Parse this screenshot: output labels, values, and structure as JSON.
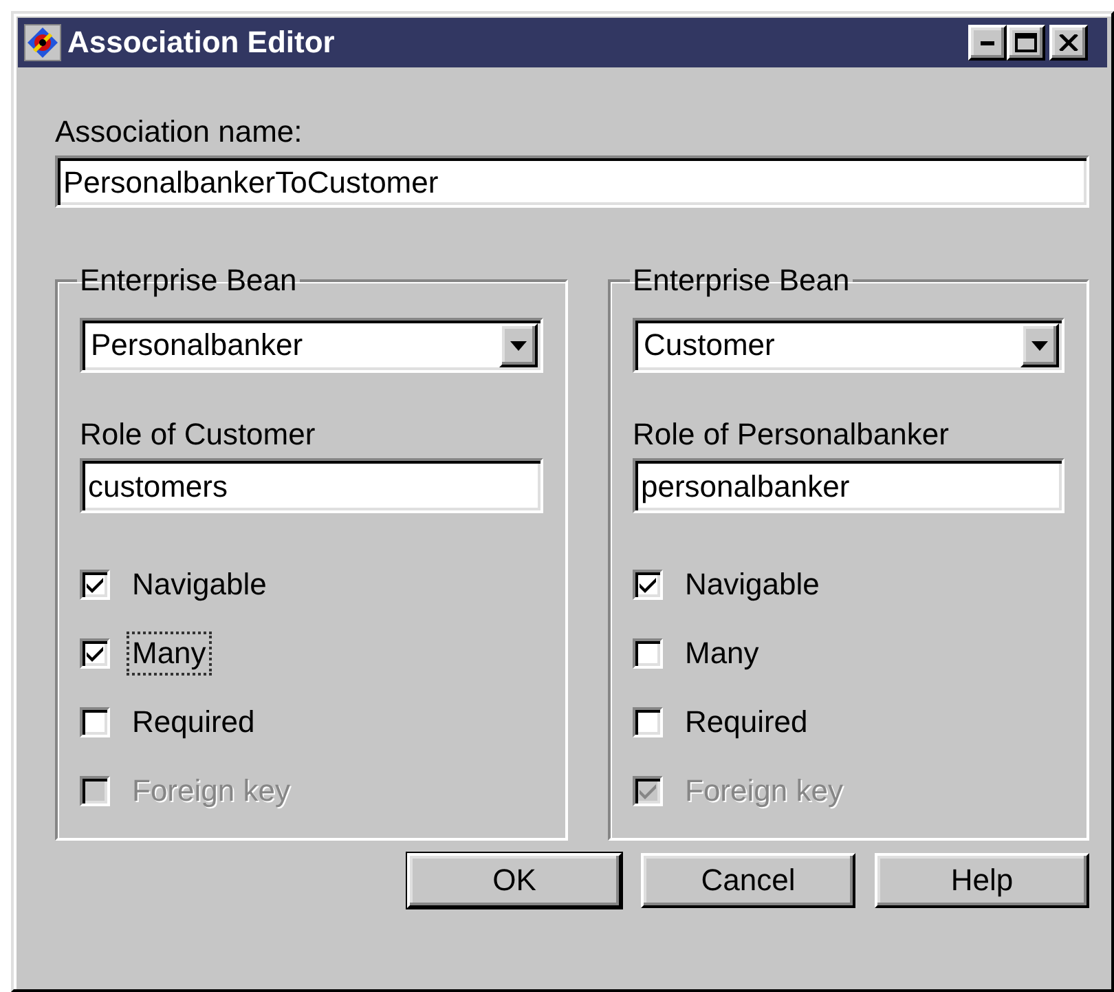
{
  "window": {
    "title": "Association Editor"
  },
  "association_name": {
    "label": "Association name:",
    "value": "PersonalbankerToCustomer"
  },
  "ends": [
    {
      "group_title": "Enterprise Bean",
      "bean": "Personalbanker",
      "role_label": "Role of Customer",
      "role_value": "customers",
      "options": [
        {
          "label": "Navigable",
          "checked": true,
          "disabled": false,
          "focused": false
        },
        {
          "label": "Many",
          "checked": true,
          "disabled": false,
          "focused": true
        },
        {
          "label": "Required",
          "checked": false,
          "disabled": false,
          "focused": false
        },
        {
          "label": "Foreign key",
          "checked": false,
          "disabled": true,
          "focused": false
        }
      ]
    },
    {
      "group_title": "Enterprise Bean",
      "bean": "Customer",
      "role_label": "Role of Personalbanker",
      "role_value": "personalbanker",
      "options": [
        {
          "label": "Navigable",
          "checked": true,
          "disabled": false,
          "focused": false
        },
        {
          "label": "Many",
          "checked": false,
          "disabled": false,
          "focused": false
        },
        {
          "label": "Required",
          "checked": false,
          "disabled": false,
          "focused": false
        },
        {
          "label": "Foreign key",
          "checked": true,
          "disabled": true,
          "focused": false
        }
      ]
    }
  ],
  "buttons": [
    {
      "label": "OK",
      "default": true
    },
    {
      "label": "Cancel",
      "default": false
    },
    {
      "label": "Help",
      "default": false
    }
  ]
}
